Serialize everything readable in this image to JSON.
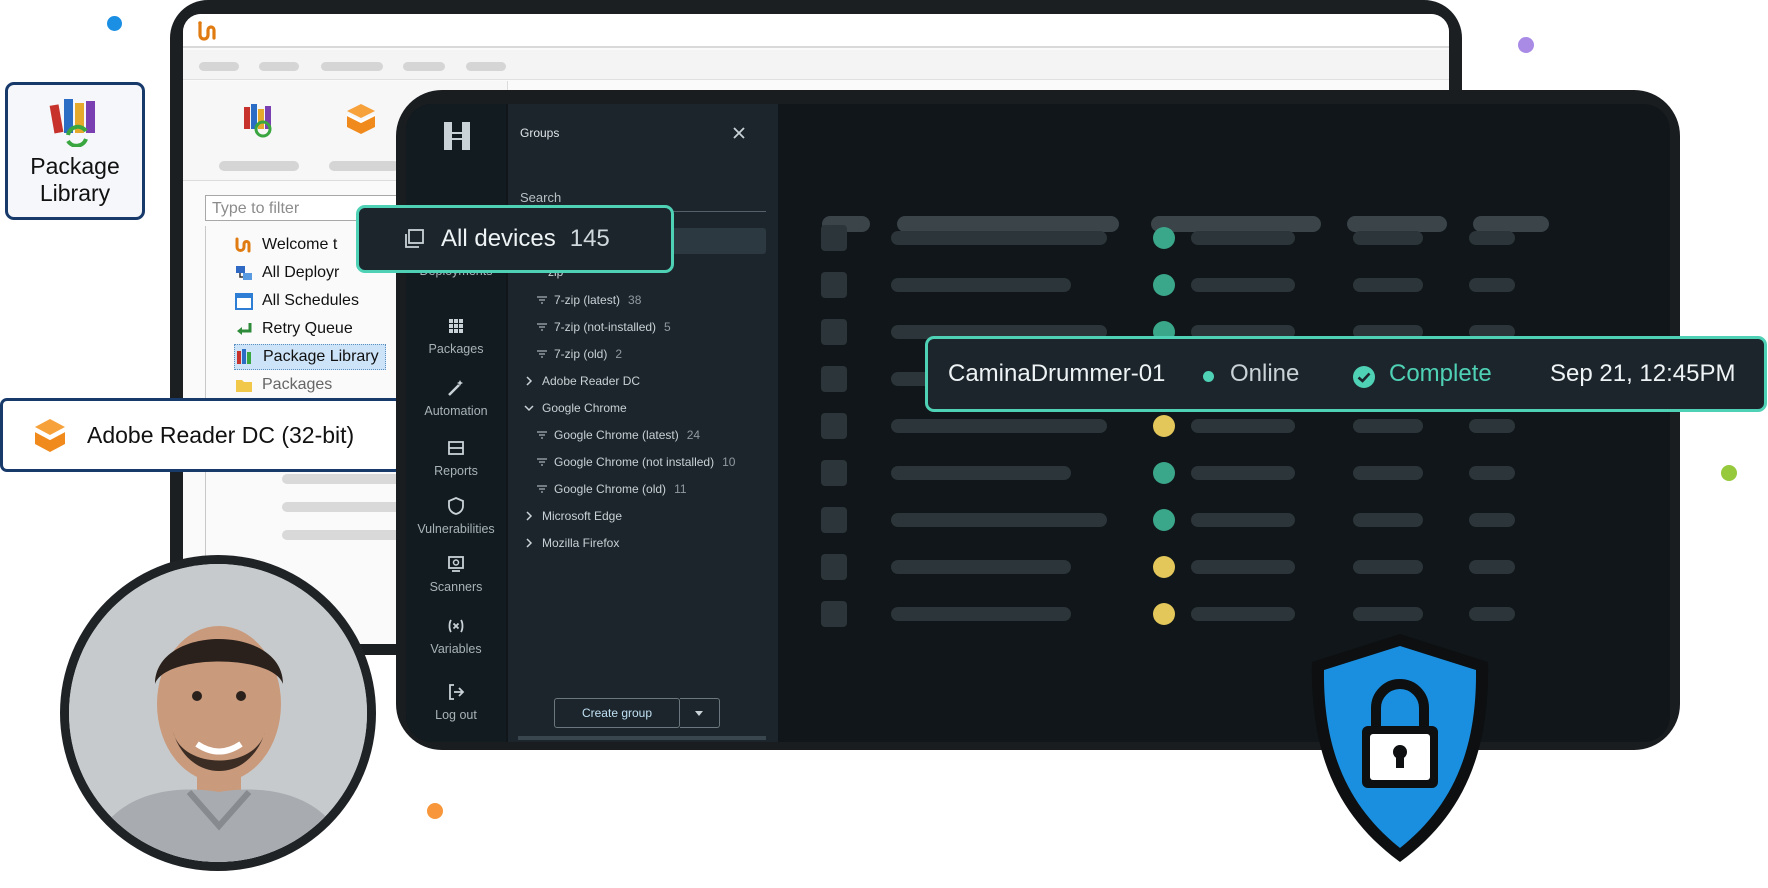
{
  "colors": {
    "accent_teal": "#4fd1b6",
    "status_green": "#3aa68a",
    "status_yellow": "#e3c75a",
    "brand_navy": "#173a6b",
    "shield_blue": "#1a8fe0"
  },
  "legacy": {
    "filter_placeholder": "Type to filter",
    "tree": [
      {
        "label": "Welcome t",
        "icon": "pdq-logo-icon"
      },
      {
        "label": "All Deployr",
        "icon": "deployments-icon"
      },
      {
        "label": "All Schedules",
        "icon": "calendar-icon"
      },
      {
        "label": "Retry Queue",
        "icon": "retry-arrow-icon"
      },
      {
        "label": "Package Library",
        "icon": "package-library-icon",
        "selected": true
      },
      {
        "label": "Packages",
        "icon": "folder-icon"
      }
    ]
  },
  "callouts": {
    "package_library": "Package Library",
    "adobe_package": "Adobe Reader DC (32-bit)"
  },
  "nav": [
    {
      "label": "Deployments",
      "icon": "deployments-icon"
    },
    {
      "label": "Packages",
      "icon": "grid-icon"
    },
    {
      "label": "Automation",
      "icon": "magic-wand-icon"
    },
    {
      "label": "Reports",
      "icon": "reports-icon"
    },
    {
      "label": "Vulnerabilities",
      "icon": "shield-outline-icon"
    },
    {
      "label": "Scanners",
      "icon": "scanner-icon"
    },
    {
      "label": "Variables",
      "icon": "variables-icon"
    },
    {
      "label": "Log out",
      "icon": "logout-icon"
    }
  ],
  "groups": {
    "title": "Groups",
    "search_label": "Search",
    "create_group_label": "Create group",
    "all_devices": {
      "label": "All devices",
      "count": "145"
    },
    "items": [
      {
        "label": "zip",
        "count": "",
        "type": "filter"
      },
      {
        "label": "7-zip (latest)",
        "count": "38",
        "type": "filter"
      },
      {
        "label": "7-zip (not-installed)",
        "count": "5",
        "type": "filter"
      },
      {
        "label": "7-zip (old)",
        "count": "2",
        "type": "filter"
      },
      {
        "label": "Adobe Reader DC",
        "count": "",
        "type": "folder-collapsed"
      },
      {
        "label": "Google Chrome",
        "count": "",
        "type": "folder-expanded"
      },
      {
        "label": "Google Chrome (latest)",
        "count": "24",
        "type": "filter"
      },
      {
        "label": "Google Chrome (not installed)",
        "count": "10",
        "type": "filter"
      },
      {
        "label": "Google Chrome (old)",
        "count": "11",
        "type": "filter"
      },
      {
        "label": "Microsoft Edge",
        "count": "",
        "type": "folder-collapsed"
      },
      {
        "label": "Mozilla Firefox",
        "count": "",
        "type": "folder-collapsed"
      }
    ]
  },
  "device_table": {
    "row_status": [
      "green",
      "green",
      "green",
      "green",
      "yellow",
      "green",
      "green",
      "yellow",
      "yellow"
    ]
  },
  "device_detail": {
    "name": "CaminaDrummer-01",
    "online": "Online",
    "status": "Complete",
    "timestamp": "Sep 21, 12:45PM"
  }
}
